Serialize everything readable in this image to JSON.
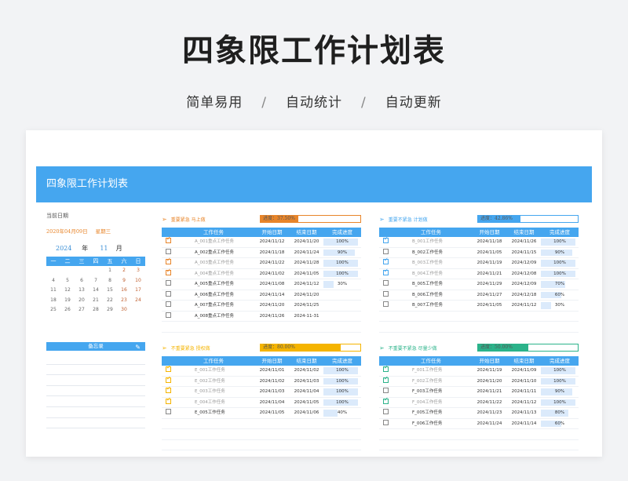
{
  "header": {
    "title": "四象限工作计划表",
    "tag1": "简单易用",
    "tag2": "自动统计",
    "tag3": "自动更新",
    "sep": "/"
  },
  "banner": {
    "title": "四象限工作计划表"
  },
  "left": {
    "date_label": "当前日期",
    "date_value": "2020年04月09日",
    "weekday": "星期三",
    "year": "2024",
    "year_unit": "年",
    "month": "11",
    "month_unit": "月",
    "weekdays": [
      "一",
      "二",
      "三",
      "四",
      "五",
      "六",
      "日"
    ],
    "days": [
      "",
      "",
      "",
      "",
      "1",
      "2",
      "3",
      "4",
      "5",
      "6",
      "7",
      "8",
      "9",
      "10",
      "11",
      "12",
      "13",
      "14",
      "15",
      "16",
      "17",
      "18",
      "19",
      "20",
      "21",
      "22",
      "23",
      "24",
      "25",
      "26",
      "27",
      "28",
      "29",
      "30",
      ""
    ],
    "memo_label": "备忘录"
  },
  "columns": {
    "task": "工作任务",
    "start": "开始日期",
    "end": "结束日期",
    "progress": "完成进度"
  },
  "colors": {
    "accent": "#45a6ef",
    "q1": "#e8852a",
    "q2": "#45a6ef",
    "q3": "#f5b400",
    "q4": "#2bb38a"
  },
  "quadrants": [
    {
      "title": "重要紧急 马上做",
      "progress_text": "进度：37.50%",
      "progress": 0.375,
      "rows": [
        {
          "checked": true,
          "task": "A_001重点工作任务",
          "start": "2024/11/12",
          "end": "2024/11/20",
          "progress": "100%",
          "pct": 1.0
        },
        {
          "checked": false,
          "task": "A_002重点工作任务",
          "start": "2024/11/18",
          "end": "2024/11/24",
          "progress": "90%",
          "pct": 0.9
        },
        {
          "checked": true,
          "task": "A_003重点工作任务",
          "start": "2024/11/22",
          "end": "2024/11/28",
          "progress": "100%",
          "pct": 1.0
        },
        {
          "checked": true,
          "task": "A_004重点工作任务",
          "start": "2024/11/02",
          "end": "2024/11/05",
          "progress": "100%",
          "pct": 1.0
        },
        {
          "checked": false,
          "task": "A_005重点工作任务",
          "start": "2024/11/08",
          "end": "2024/11/12",
          "progress": "30%",
          "pct": 0.3
        },
        {
          "checked": false,
          "task": "A_006重点工作任务",
          "start": "2024/11/14",
          "end": "2024/11/20",
          "progress": "",
          "pct": 0
        },
        {
          "checked": false,
          "task": "A_007重点工作任务",
          "start": "2024/11/20",
          "end": "2024/11/25",
          "progress": "",
          "pct": 0
        },
        {
          "checked": false,
          "task": "A_008重点工作任务",
          "start": "2024/11/26",
          "end": "2024-11-31",
          "progress": "",
          "pct": 0
        }
      ]
    },
    {
      "title": "重要不紧急 计划做",
      "progress_text": "进度：42.86%",
      "progress": 0.4286,
      "rows": [
        {
          "checked": true,
          "task": "B_001工作任务",
          "start": "2024/11/18",
          "end": "2024/11/26",
          "progress": "100%",
          "pct": 1.0
        },
        {
          "checked": false,
          "task": "B_002工作任务",
          "start": "2024/11/05",
          "end": "2024/11/15",
          "progress": "90%",
          "pct": 0.9
        },
        {
          "checked": true,
          "task": "B_003工作任务",
          "start": "2024/11/19",
          "end": "2024/12/09",
          "progress": "100%",
          "pct": 1.0
        },
        {
          "checked": true,
          "task": "B_004工作任务",
          "start": "2024/11/21",
          "end": "2024/12/08",
          "progress": "100%",
          "pct": 1.0
        },
        {
          "checked": false,
          "task": "B_005工作任务",
          "start": "2024/11/29",
          "end": "2024/12/09",
          "progress": "70%",
          "pct": 0.7
        },
        {
          "checked": false,
          "task": "B_006工作任务",
          "start": "2024/11/27",
          "end": "2024/12/18",
          "progress": "60%",
          "pct": 0.6
        },
        {
          "checked": false,
          "task": "B_007工作任务",
          "start": "2024/11/05",
          "end": "2024/11/12",
          "progress": "30%",
          "pct": 0.3
        }
      ]
    },
    {
      "title": "不重要紧急 授权做",
      "progress_text": "进度：80.00%",
      "progress": 0.8,
      "rows": [
        {
          "checked": true,
          "task": "E_001工作任务",
          "start": "2024/11/01",
          "end": "2024/11/02",
          "progress": "100%",
          "pct": 1.0
        },
        {
          "checked": true,
          "task": "E_002工作任务",
          "start": "2024/11/02",
          "end": "2024/11/03",
          "progress": "100%",
          "pct": 1.0
        },
        {
          "checked": true,
          "task": "E_003工作任务",
          "start": "2024/11/03",
          "end": "2024/11/04",
          "progress": "100%",
          "pct": 1.0
        },
        {
          "checked": true,
          "task": "E_004工作任务",
          "start": "2024/11/04",
          "end": "2024/11/05",
          "progress": "100%",
          "pct": 1.0
        },
        {
          "checked": false,
          "task": "E_005工作任务",
          "start": "2024/11/05",
          "end": "2024/11/06",
          "progress": "40%",
          "pct": 0.4
        }
      ]
    },
    {
      "title": "不重要不紧急 尽量少做",
      "progress_text": "进度：50.00%",
      "progress": 0.5,
      "rows": [
        {
          "checked": true,
          "task": "F_001工作任务",
          "start": "2024/11/19",
          "end": "2024/11/09",
          "progress": "100%",
          "pct": 1.0
        },
        {
          "checked": true,
          "task": "F_002工作任务",
          "start": "2024/11/20",
          "end": "2024/11/10",
          "progress": "100%",
          "pct": 1.0
        },
        {
          "checked": false,
          "task": "F_003工作任务",
          "start": "2024/11/21",
          "end": "2024/11/11",
          "progress": "90%",
          "pct": 0.9
        },
        {
          "checked": true,
          "task": "F_004工作任务",
          "start": "2024/11/22",
          "end": "2024/11/12",
          "progress": "100%",
          "pct": 1.0
        },
        {
          "checked": false,
          "task": "F_005工作任务",
          "start": "2024/11/23",
          "end": "2024/11/13",
          "progress": "80%",
          "pct": 0.8
        },
        {
          "checked": false,
          "task": "F_006工作任务",
          "start": "2024/11/24",
          "end": "2024/11/14",
          "progress": "60%",
          "pct": 0.6
        }
      ]
    }
  ]
}
